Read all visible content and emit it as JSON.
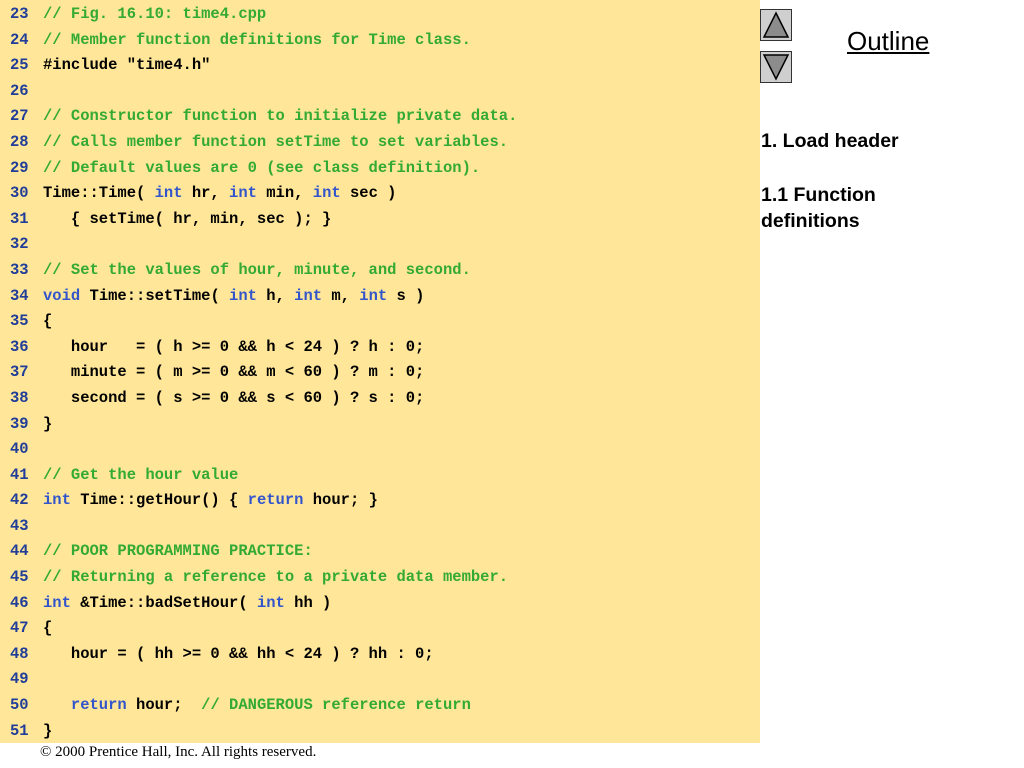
{
  "outline": {
    "title": "Outline",
    "items": [
      "1. Load header",
      "1.1 Function definitions"
    ]
  },
  "nav": {
    "up_icon": "triangle-up-icon",
    "down_icon": "triangle-down-icon"
  },
  "footer": {
    "copyright": "© 2000 Prentice Hall, Inc.  All rights reserved."
  },
  "colors": {
    "code_background": "#ffe699",
    "comment": "#33aa33",
    "keyword": "#3355cc",
    "line_number": "#1f3d99",
    "text": "#000000"
  },
  "code": [
    {
      "n": "23",
      "tokens": [
        {
          "t": "c",
          "s": "// Fig. 16.10: time4.cpp"
        }
      ]
    },
    {
      "n": "24",
      "tokens": [
        {
          "t": "c",
          "s": "// Member function definitions for Time class."
        }
      ]
    },
    {
      "n": "25",
      "tokens": [
        {
          "t": "n",
          "s": "#include \"time4.h\""
        }
      ]
    },
    {
      "n": "26",
      "tokens": []
    },
    {
      "n": "27",
      "tokens": [
        {
          "t": "c",
          "s": "// Constructor function to initialize private data."
        }
      ]
    },
    {
      "n": "28",
      "tokens": [
        {
          "t": "c",
          "s": "// Calls member function setTime to set variables."
        }
      ]
    },
    {
      "n": "29",
      "tokens": [
        {
          "t": "c",
          "s": "// Default values are 0 (see class definition)."
        }
      ]
    },
    {
      "n": "30",
      "tokens": [
        {
          "t": "n",
          "s": "Time::Time( "
        },
        {
          "t": "k",
          "s": "int"
        },
        {
          "t": "n",
          "s": " hr, "
        },
        {
          "t": "k",
          "s": "int"
        },
        {
          "t": "n",
          "s": " min, "
        },
        {
          "t": "k",
          "s": "int"
        },
        {
          "t": "n",
          "s": " sec )"
        }
      ]
    },
    {
      "n": "31",
      "tokens": [
        {
          "t": "n",
          "s": "   { setTime( hr, min, sec ); }"
        }
      ]
    },
    {
      "n": "32",
      "tokens": []
    },
    {
      "n": "33",
      "tokens": [
        {
          "t": "c",
          "s": "// Set the values of hour, minute, and second."
        }
      ]
    },
    {
      "n": "34",
      "tokens": [
        {
          "t": "k",
          "s": "void"
        },
        {
          "t": "n",
          "s": " Time::setTime( "
        },
        {
          "t": "k",
          "s": "int"
        },
        {
          "t": "n",
          "s": " h, "
        },
        {
          "t": "k",
          "s": "int"
        },
        {
          "t": "n",
          "s": " m, "
        },
        {
          "t": "k",
          "s": "int"
        },
        {
          "t": "n",
          "s": " s )"
        }
      ]
    },
    {
      "n": "35",
      "tokens": [
        {
          "t": "n",
          "s": "{"
        }
      ]
    },
    {
      "n": "36",
      "tokens": [
        {
          "t": "n",
          "s": "   hour   = ( h >= 0 && h < 24 ) ? h : 0;"
        }
      ]
    },
    {
      "n": "37",
      "tokens": [
        {
          "t": "n",
          "s": "   minute = ( m >= 0 && m < 60 ) ? m : 0;"
        }
      ]
    },
    {
      "n": "38",
      "tokens": [
        {
          "t": "n",
          "s": "   second = ( s >= 0 && s < 60 ) ? s : 0;"
        }
      ]
    },
    {
      "n": "39",
      "tokens": [
        {
          "t": "n",
          "s": "}"
        }
      ]
    },
    {
      "n": "40",
      "tokens": []
    },
    {
      "n": "41",
      "tokens": [
        {
          "t": "c",
          "s": "// Get the hour value"
        }
      ]
    },
    {
      "n": "42",
      "tokens": [
        {
          "t": "k",
          "s": "int"
        },
        {
          "t": "n",
          "s": " Time::getHour() { "
        },
        {
          "t": "k",
          "s": "return"
        },
        {
          "t": "n",
          "s": " hour; }"
        }
      ]
    },
    {
      "n": "43",
      "tokens": []
    },
    {
      "n": "44",
      "tokens": [
        {
          "t": "c",
          "s": "// POOR PROGRAMMING PRACTICE:"
        }
      ]
    },
    {
      "n": "45",
      "tokens": [
        {
          "t": "c",
          "s": "// Returning a reference to a private data member."
        }
      ]
    },
    {
      "n": "46",
      "tokens": [
        {
          "t": "k",
          "s": "int"
        },
        {
          "t": "n",
          "s": " &Time::badSetHour( "
        },
        {
          "t": "k",
          "s": "int"
        },
        {
          "t": "n",
          "s": " hh )"
        }
      ]
    },
    {
      "n": "47",
      "tokens": [
        {
          "t": "n",
          "s": "{"
        }
      ]
    },
    {
      "n": "48",
      "tokens": [
        {
          "t": "n",
          "s": "   hour = ( hh >= 0 && hh < 24 ) ? hh : 0;"
        }
      ]
    },
    {
      "n": "49",
      "tokens": []
    },
    {
      "n": "50",
      "tokens": [
        {
          "t": "n",
          "s": "   "
        },
        {
          "t": "k",
          "s": "return"
        },
        {
          "t": "n",
          "s": " hour;  "
        },
        {
          "t": "c",
          "s": "// DANGEROUS reference return"
        }
      ]
    },
    {
      "n": "51",
      "tokens": [
        {
          "t": "n",
          "s": "}"
        }
      ]
    }
  ]
}
